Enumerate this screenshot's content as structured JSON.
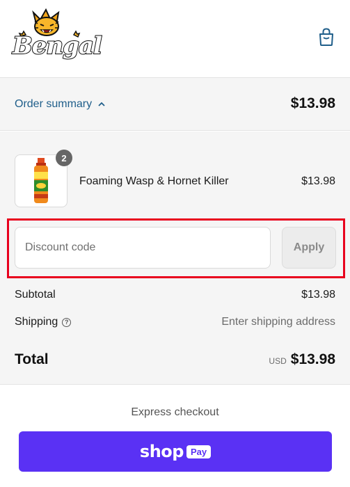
{
  "header": {
    "logo_text": "Bengal",
    "cart_icon": "shopping-bag-icon"
  },
  "order_summary": {
    "toggle_label": "Order summary",
    "toggle_icon": "chevron-up-icon",
    "total": "$13.98"
  },
  "cart": {
    "items": [
      {
        "name": "Foaming Wasp & Hornet Killer",
        "quantity": "2",
        "price": "$13.98",
        "image": "spray-can-product-image"
      }
    ]
  },
  "discount": {
    "placeholder": "Discount code",
    "value": "",
    "apply_label": "Apply"
  },
  "totals": {
    "subtotal_label": "Subtotal",
    "subtotal_value": "$13.98",
    "shipping_label": "Shipping",
    "shipping_help_icon": "question-circle-icon",
    "shipping_value": "Enter shipping address",
    "total_label": "Total",
    "currency": "USD",
    "total_value": "$13.98"
  },
  "express": {
    "label": "Express checkout",
    "shop_word": "shop",
    "pay_word": "Pay"
  },
  "colors": {
    "link": "#1f5e8a",
    "shop_pay": "#5a31f4",
    "highlight": "#e8001d"
  }
}
